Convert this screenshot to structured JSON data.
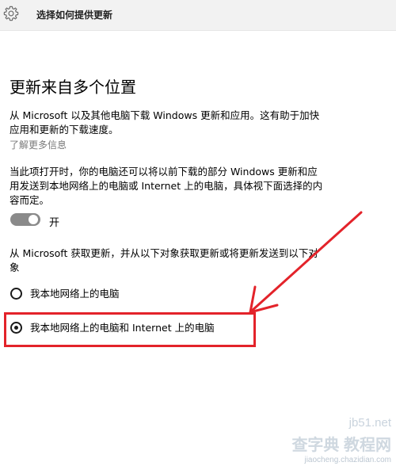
{
  "window": {
    "icon": "gear-icon",
    "title": "选择如何提供更新"
  },
  "section": {
    "heading": "更新来自多个位置",
    "description": "从 Microsoft 以及其他电脑下载 Windows 更新和应用。这有助于加快应用和更新的下载速度。",
    "learn_more": "了解更多信息",
    "toggle_description": "当此项打开时，你的电脑还可以将以前下载的部分 Windows 更新和应用发送到本地网络上的电脑或 Internet 上的电脑，具体视下面选择的内容而定。",
    "toggle": {
      "state": "on",
      "label": "开"
    },
    "options_description": "从 Microsoft 获取更新，并从以下对象获取更新或将更新发送到以下对象",
    "options": [
      {
        "label": "我本地网络上的电脑",
        "selected": false
      },
      {
        "label": "我本地网络上的电脑和 Internet 上的电脑",
        "selected": true
      }
    ]
  },
  "annotation": {
    "color": "#e3232a"
  },
  "watermark": {
    "site": "jb51.net",
    "brand": "查字典 教程网",
    "url": "jiaocheng.chazidian.com"
  }
}
